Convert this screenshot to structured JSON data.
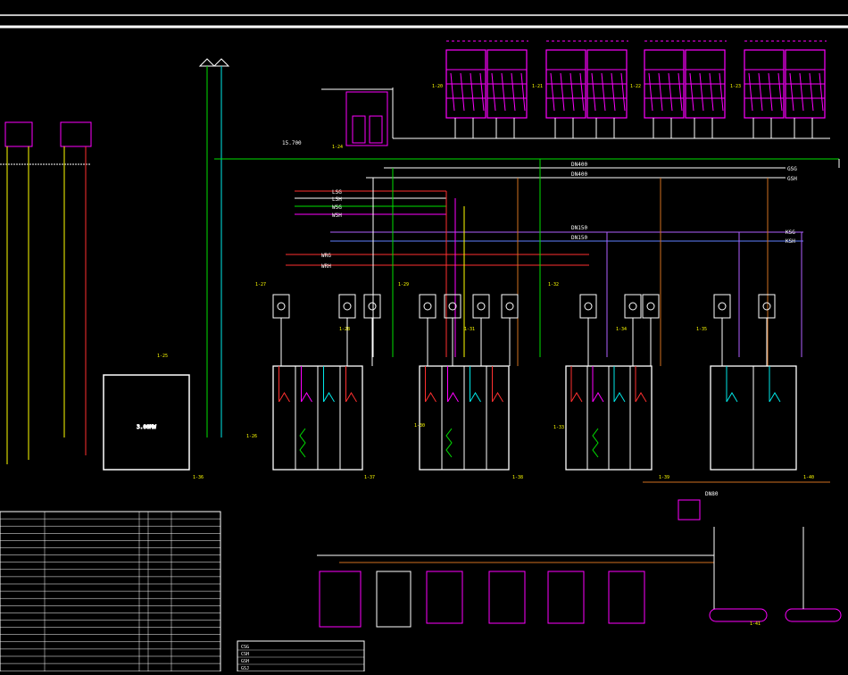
{
  "colors": {
    "white": "#ffffff",
    "yellow": "#ffff00",
    "red": "#ff3030",
    "green": "#00e000",
    "cyan": "#00e8e8",
    "magenta": "#ff00ff",
    "orange": "#d07020",
    "violet": "#b060ff",
    "blue": "#6080ff",
    "dimgray": "#909090"
  },
  "labels": {
    "pipe_lsg": "LSG",
    "pipe_lsh": "LSH",
    "pipe_wsg": "WSG",
    "pipe_wsh": "WSH",
    "pipe_wrg": "WRG",
    "pipe_wrh": "WRH",
    "pipe_gsg": "GSG",
    "pipe_gsh": "GSH",
    "pipe_ksg": "KSG",
    "pipe_ksh": "KSH",
    "dn_a": "DN400",
    "dn_b": "DN400",
    "dn_c": "DN150",
    "dn_d": "DN150",
    "dn_e": "DN80",
    "elev": "15.700",
    "boiler_caption": "3.00MW",
    "callouts": [
      "1-20",
      "1-21",
      "1-22",
      "1-23",
      "1-24",
      "1-25",
      "1-26",
      "1-27",
      "1-28",
      "1-29",
      "1-30",
      "1-31",
      "1-32",
      "1-33",
      "1-34",
      "1-35",
      "1-36",
      "1-37",
      "1-38",
      "1-39",
      "1-40",
      "1-41"
    ]
  },
  "legend_rows": [
    {
      "code": "CSG"
    },
    {
      "code": "CSH"
    },
    {
      "code": "GSH"
    },
    {
      "code": "GSJ"
    }
  ]
}
